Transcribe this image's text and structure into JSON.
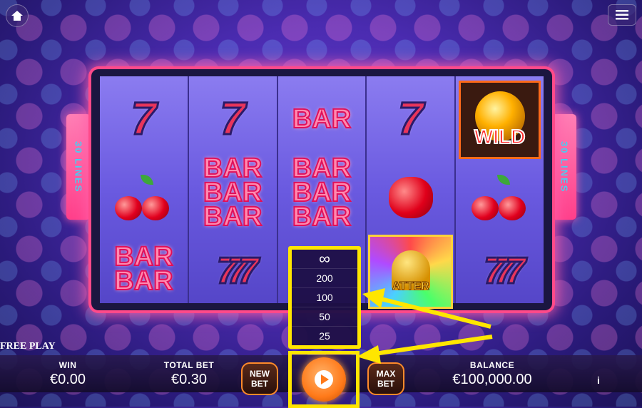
{
  "side_panels": {
    "left": "30 LINES",
    "right": "30 LINES"
  },
  "reels": [
    [
      "seven",
      "cherries",
      "bar-bar"
    ],
    [
      "seven",
      "bar-bar-bar",
      "triple-seven"
    ],
    [
      "bar",
      "bar-bar-bar",
      "hidden"
    ],
    [
      "seven",
      "apple",
      "scatter"
    ],
    [
      "wild",
      "cherries",
      "triple-seven"
    ]
  ],
  "symbols": {
    "seven": "7",
    "bar": "BAR",
    "wild": "WILD",
    "scatter": "ATTER"
  },
  "autoplay_menu": {
    "items": [
      "∞",
      "200",
      "100",
      "50",
      "25"
    ]
  },
  "bottom": {
    "free_play": "FREE PLAY",
    "win_label": "WIN",
    "win_value": "€0.00",
    "total_bet_label": "TOTAL BET",
    "total_bet_value": "€0.30",
    "new_bet_label": "NEW\nBET",
    "max_bet_label": "MAX\nBET",
    "balance_label": "BALANCE",
    "balance_value": "€100,000.00",
    "info_label": "i"
  },
  "colors": {
    "highlight": "#ffe600",
    "frame": "#ff4a8a",
    "accent": "#ff7a1a"
  }
}
